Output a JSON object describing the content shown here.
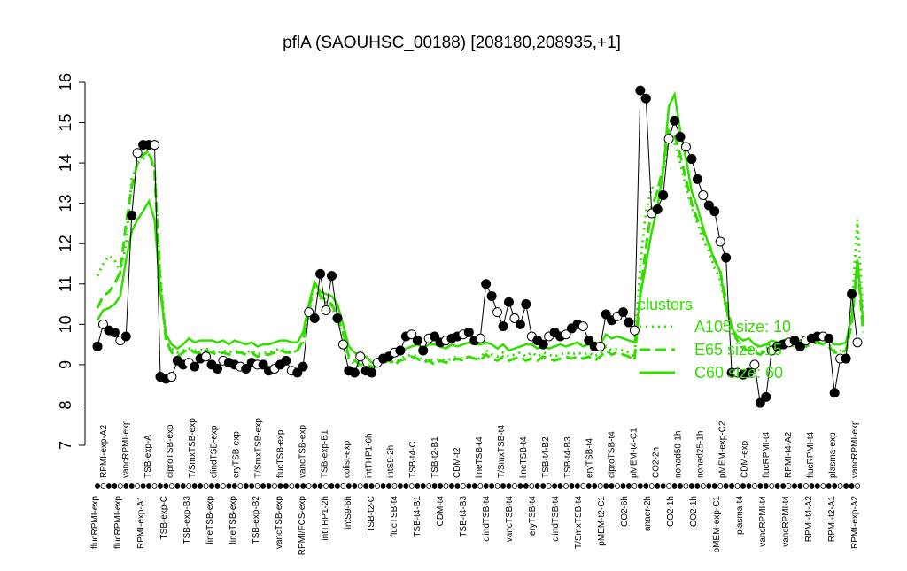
{
  "chart_data": {
    "type": "line",
    "title": "pflA (SAOUHSC_00188) [208180,208935,+1]",
    "xlabel": "",
    "ylabel": "",
    "ylim": [
      7,
      16
    ],
    "yticks": [
      7,
      8,
      9,
      10,
      11,
      12,
      13,
      14,
      15,
      16
    ],
    "legend": {
      "title": "clusters",
      "placement": "right",
      "entries": [
        {
          "label": "A105 size: 10",
          "style": "dotted"
        },
        {
          "label": "E65 size: 15",
          "style": "dashed"
        },
        {
          "label": "C60 size: 60",
          "style": "solid"
        }
      ],
      "color": "#33dd00"
    },
    "x_labels_upper": [
      "RPMI-exp-A2",
      "vancRPMI-exp",
      "TSB-exp-A",
      "ciproTSB-exp",
      "T/SmxTSB-exp",
      "clindTSB-exp",
      "eryTSB-exp",
      "T/SmxTSB-exp",
      "flucTSB-exp",
      "vancTSB-exp",
      "TSB-exp-B1",
      "colist-exp",
      "intTHP1-6h",
      "intS9-2h",
      "TSB-t4-C",
      "TSB-t2-B1",
      "CDM-t2",
      "lineTSB-t4",
      "T/SmxTSB-t4",
      "lineTSB-t4",
      "TSB-t4-B2",
      "TSB-t4-B3",
      "eryTSB-t4",
      "ciproTSB-t4",
      "pMEM-t4-C1",
      "CO2-2h",
      "nonad50-1h",
      "nonad25-1h",
      "pMEM-exp-C2",
      "CDM-exp",
      "flucRPMI-t4",
      "RPMI-t4-A2",
      "flucRPMI-t4",
      "plasma-exp",
      "vancRPMI-exp"
    ],
    "x_labels_lower": [
      "flucRPMI-exp",
      "flucRPMI-exp",
      "RPMI-exp-A1",
      "TSB-exp-C",
      "TSB-exp-B3",
      "lineTSB-exp",
      "lineTSB-exp",
      "TSB-exp-B2",
      "vancTSB-exp",
      "RPMI/FCS-exp",
      "intTHP1-2h",
      "intS9-6h",
      "TSB-t2-C",
      "flucTSB-t4",
      "TSB-t4-B1",
      "CDM-t4",
      "TSB-t4-B3",
      "clindTSB-t4",
      "vancTSB-t4",
      "eryTSB-t4",
      "clindTSB-t4",
      "T/SmxTSB-t4",
      "pMEM-t2-C1",
      "CO2-6h",
      "anaer-2h",
      "CO2-1h",
      "CO2-1h",
      "pMEM-exp-C1",
      "plasma-t4",
      "vancRPMI-t4",
      "vancRPMI-t4",
      "RPMI-t4-A2",
      "RPMI-t2-A1",
      "RPMI-exp-A2"
    ],
    "series": [
      {
        "name": "",
        "style": "points-line",
        "y": [
          9.45,
          10.0,
          9.85,
          9.8,
          9.6,
          9.7,
          12.7,
          14.25,
          14.45,
          14.45,
          14.45,
          8.7,
          8.65,
          8.7,
          9.1,
          9.0,
          9.05,
          8.95,
          9.15,
          9.2,
          9.0,
          8.9,
          9.1,
          9.05,
          9.0,
          8.95,
          8.9,
          9.05,
          9.0,
          9.0,
          8.85,
          8.9,
          9.0,
          9.1,
          8.85,
          8.8,
          8.95,
          10.3,
          10.15,
          11.25,
          10.35,
          11.2,
          10.15,
          9.5,
          8.85,
          8.8,
          9.2,
          8.85,
          8.8,
          9.05,
          9.15,
          9.2,
          9.3,
          9.35,
          9.7,
          9.75,
          9.6,
          9.35,
          9.65,
          9.7,
          9.55,
          9.6,
          9.65,
          9.7,
          9.75,
          9.8,
          9.6,
          9.65,
          11.0,
          10.7,
          10.3,
          9.95,
          10.55,
          10.15,
          10.0,
          10.5,
          9.7,
          9.6,
          9.5,
          9.7,
          9.8,
          9.7,
          9.75,
          9.9,
          10.0,
          9.95,
          9.6,
          9.45,
          9.45,
          10.25,
          10.1,
          10.2,
          10.3,
          10.05,
          9.85,
          15.8,
          15.6,
          12.75,
          12.85,
          13.2,
          14.6,
          15.05,
          14.65,
          14.4,
          14.1,
          13.6,
          13.2,
          12.95,
          12.8,
          12.05,
          11.65,
          8.8,
          8.8,
          8.75,
          8.8,
          9.0,
          8.05,
          8.2,
          9.35,
          9.45,
          9.5,
          9.55,
          9.6,
          9.45,
          9.6,
          9.65,
          9.7,
          9.7,
          9.65,
          8.3,
          9.15,
          9.15,
          10.75,
          9.55
        ]
      },
      {
        "name": "C60 size: 60",
        "style": "solid",
        "y": [
          10.1,
          10.35,
          10.4,
          10.5,
          10.7,
          11.6,
          12.3,
          12.6,
          12.8,
          13.05,
          12.6,
          10.8,
          9.75,
          9.5,
          9.4,
          9.5,
          9.65,
          9.55,
          9.6,
          9.6,
          9.6,
          9.55,
          9.6,
          9.5,
          9.6,
          9.55,
          9.5,
          9.55,
          9.45,
          9.5,
          9.5,
          9.55,
          9.6,
          9.6,
          9.55,
          9.55,
          9.8,
          10.5,
          11.05,
          10.8,
          10.75,
          10.7,
          10.5,
          10.0,
          9.45,
          9.3,
          9.2,
          9.2,
          9.05,
          9.0,
          9.1,
          9.2,
          9.25,
          9.3,
          9.4,
          9.45,
          9.5,
          9.4,
          9.5,
          9.5,
          9.45,
          9.4,
          9.5,
          9.45,
          9.5,
          9.55,
          9.5,
          9.5,
          9.55,
          9.5,
          9.4,
          9.5,
          9.35,
          9.4,
          9.45,
          9.5,
          9.5,
          9.4,
          9.45,
          9.4,
          9.45,
          9.5,
          9.45,
          9.5,
          9.55,
          9.45,
          9.5,
          9.4,
          9.5,
          9.75,
          9.65,
          9.7,
          9.65,
          9.6,
          9.55,
          10.7,
          11.5,
          12.3,
          12.9,
          13.8,
          15.4,
          15.7,
          14.8,
          14.1,
          13.3,
          12.9,
          12.4,
          11.95,
          11.6,
          11.3,
          10.4,
          9.9,
          9.7,
          9.6,
          9.65,
          9.5,
          9.45,
          9.5,
          9.6,
          9.55,
          9.6,
          9.65,
          9.6,
          9.6,
          9.65,
          9.6,
          9.65,
          9.7,
          9.6,
          9.5,
          9.5,
          9.55,
          10.2,
          11.6,
          10.05
        ]
      },
      {
        "name": "E65 size: 15",
        "style": "dashed",
        "y": [
          10.4,
          10.7,
          10.8,
          11.0,
          11.3,
          12.5,
          13.4,
          14.0,
          14.2,
          14.3,
          13.8,
          11.0,
          9.6,
          9.3,
          9.2,
          9.3,
          9.4,
          9.3,
          9.3,
          9.35,
          9.3,
          9.25,
          9.3,
          9.25,
          9.3,
          9.3,
          9.25,
          9.3,
          9.2,
          9.25,
          9.25,
          9.3,
          9.35,
          9.3,
          9.3,
          9.35,
          9.6,
          10.4,
          11.0,
          10.7,
          10.6,
          10.5,
          10.2,
          9.8,
          9.2,
          9.1,
          9.0,
          9.0,
          8.95,
          8.95,
          9.05,
          9.1,
          9.0,
          9.1,
          9.15,
          9.2,
          9.15,
          9.05,
          9.1,
          9.0,
          9.1,
          9.05,
          9.1,
          9.15,
          9.1,
          9.2,
          9.15,
          9.1,
          9.25,
          9.15,
          9.1,
          9.2,
          9.1,
          9.15,
          9.2,
          9.1,
          9.15,
          9.1,
          9.2,
          9.15,
          9.1,
          9.15,
          9.2,
          9.15,
          9.2,
          9.15,
          9.2,
          9.1,
          9.2,
          9.35,
          9.25,
          9.3,
          9.25,
          9.2,
          9.1,
          10.8,
          11.9,
          12.9,
          13.3,
          13.9,
          14.8,
          14.7,
          14.2,
          13.6,
          13.0,
          12.6,
          12.3,
          12.0,
          11.6,
          11.3,
          10.6,
          9.9,
          9.6,
          9.4,
          9.35,
          9.3,
          9.25,
          9.35,
          9.4,
          9.35,
          9.45,
          9.5,
          9.45,
          9.5,
          9.45,
          9.5,
          9.55,
          9.5,
          9.45,
          9.3,
          9.3,
          9.35,
          10.0,
          11.5,
          9.8
        ]
      },
      {
        "name": "A105 size: 10",
        "style": "dotted",
        "y": [
          11.2,
          11.5,
          11.7,
          11.6,
          11.3,
          12.0,
          13.6,
          14.0,
          14.1,
          14.2,
          13.9,
          11.2,
          9.6,
          9.4,
          9.3,
          9.35,
          9.4,
          9.35,
          9.35,
          9.4,
          9.35,
          9.3,
          9.35,
          9.3,
          9.35,
          9.3,
          9.3,
          9.35,
          9.25,
          9.3,
          9.3,
          9.35,
          9.4,
          9.35,
          9.3,
          9.35,
          9.55,
          10.3,
          10.9,
          10.65,
          10.55,
          10.45,
          10.1,
          9.7,
          9.15,
          9.0,
          8.95,
          8.9,
          8.9,
          9.0,
          9.05,
          9.1,
          9.05,
          9.15,
          9.2,
          9.25,
          9.2,
          9.1,
          9.15,
          9.1,
          9.15,
          9.1,
          9.15,
          9.2,
          9.15,
          9.2,
          9.15,
          9.15,
          9.35,
          9.25,
          9.2,
          9.3,
          9.2,
          9.25,
          9.3,
          9.2,
          9.3,
          9.2,
          9.3,
          9.25,
          9.2,
          9.25,
          9.3,
          9.25,
          9.3,
          9.25,
          9.3,
          9.2,
          9.3,
          9.45,
          9.35,
          9.4,
          9.35,
          9.3,
          9.2,
          11.5,
          12.8,
          13.4,
          13.3,
          13.8,
          14.6,
          14.5,
          14.0,
          13.4,
          12.9,
          12.5,
          12.1,
          11.8,
          11.4,
          11.1,
          10.4,
          9.8,
          9.6,
          9.45,
          9.4,
          9.35,
          9.3,
          9.4,
          9.45,
          9.4,
          9.5,
          9.55,
          9.5,
          9.55,
          9.5,
          9.55,
          9.6,
          9.55,
          9.5,
          9.35,
          9.35,
          9.4,
          10.2,
          12.6,
          10.2
        ]
      }
    ],
    "line_color": "#33dd00",
    "point_filled_color": "#000000",
    "point_open_color": "#ffffff"
  }
}
